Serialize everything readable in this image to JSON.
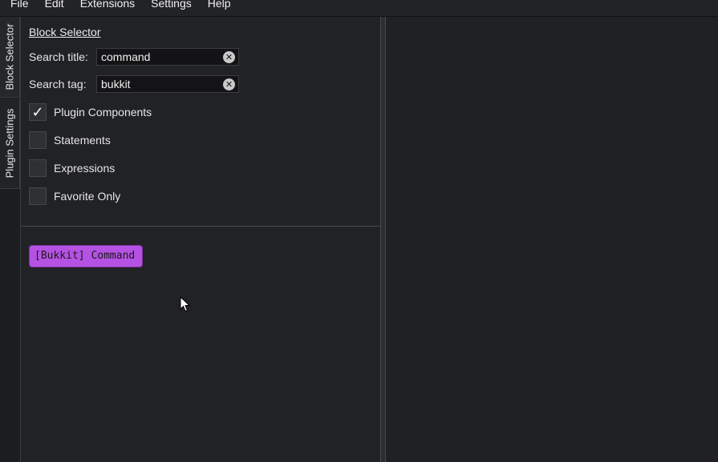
{
  "menubar": {
    "items": [
      "File",
      "Edit",
      "Extensions",
      "Settings",
      "Help"
    ]
  },
  "side_tabs": {
    "block_selector": "Block Selector",
    "plugin_settings": "Plugin Settings"
  },
  "panel": {
    "title": "Block Selector",
    "search_title": {
      "label": "Search title:",
      "value": "command"
    },
    "search_tag": {
      "label": "Search tag:",
      "value": "bukkit"
    },
    "filters": [
      {
        "label": "Plugin Components",
        "checked": true
      },
      {
        "label": "Statements",
        "checked": false
      },
      {
        "label": "Expressions",
        "checked": false
      },
      {
        "label": "Favorite Only",
        "checked": false
      }
    ],
    "results": [
      {
        "label": "[Bukkit] Command",
        "color": "#b552e3"
      }
    ]
  },
  "icons": {
    "clear": "clear-icon",
    "checkmark": "checkmark-icon",
    "cursor": "mouse-cursor-icon"
  }
}
